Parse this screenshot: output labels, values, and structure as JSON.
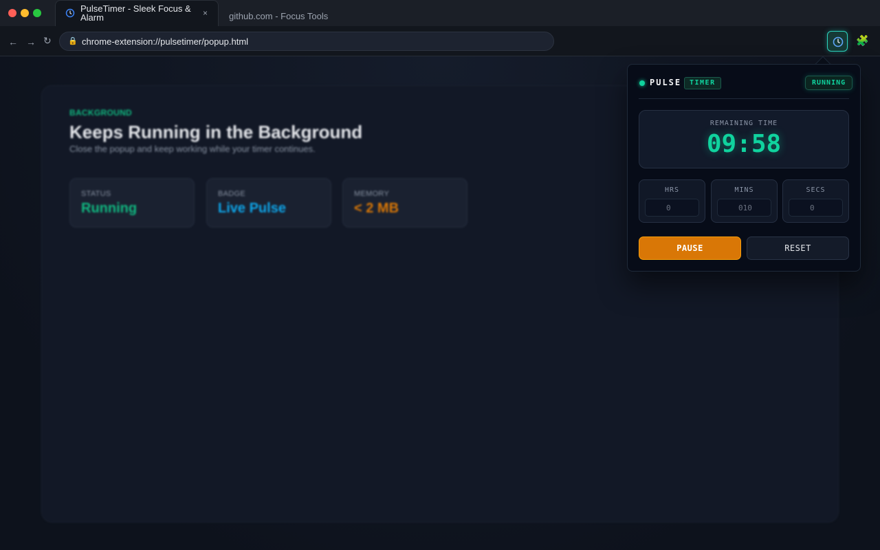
{
  "browser": {
    "active_tab_title": "PulseTimer - Sleek Focus & Alarm",
    "active_tab_close": "×",
    "inactive_tab_title": "github.com - Focus Tools",
    "nav": {
      "back": "←",
      "forward": "→",
      "reload": "↻"
    },
    "url": "chrome-extension://pulsetimer/popup.html",
    "lock_glyph": "🔒",
    "puzzle_glyph": "🧩"
  },
  "page": {
    "eyebrow": "BACKGROUND",
    "heading": "Keeps Running in the Background",
    "subtitle": "Close the popup and keep working while your timer continues.",
    "stats": [
      {
        "label": "STATUS",
        "value": "Running",
        "color": "#10b981"
      },
      {
        "label": "BADGE",
        "value": "Live Pulse",
        "color": "#0ea5e9"
      },
      {
        "label": "MEMORY",
        "value": "< 2 MB",
        "color": "#d97706"
      }
    ]
  },
  "popup": {
    "brand": "PULSE",
    "brand_badge": "TIMER",
    "state_badge": "RUNNING",
    "remaining_label": "REMAINING TIME",
    "remaining_time": "09:58",
    "fields": [
      {
        "label": "HRS",
        "value": "0"
      },
      {
        "label": "MINS",
        "value": "010"
      },
      {
        "label": "SECS",
        "value": "0"
      }
    ],
    "pause_label": "PAUSE",
    "reset_label": "RESET"
  },
  "colors": {
    "accent": "#10d39e",
    "pause": "#d97706",
    "background": "#0f1522"
  }
}
